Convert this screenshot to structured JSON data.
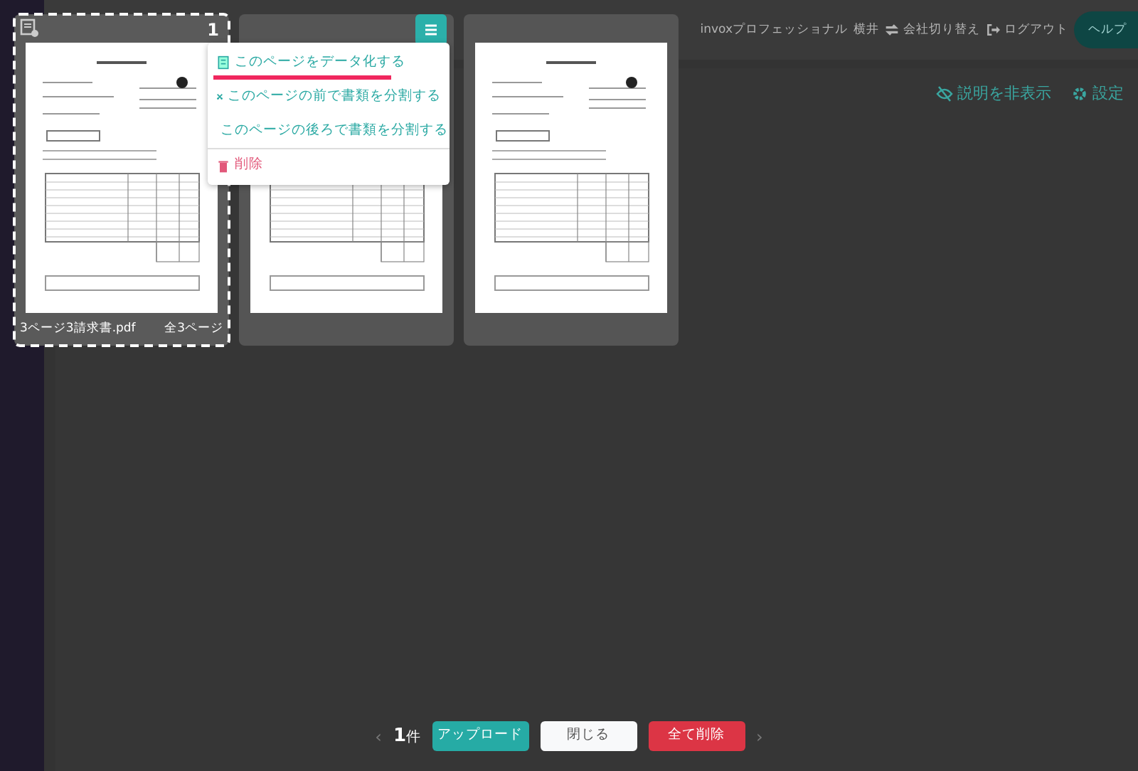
{
  "header": {
    "plan": "invoxプロフェッショナル",
    "user": "横井",
    "links": [
      {
        "kind": "switch",
        "label": "会社切り替え"
      },
      {
        "kind": "logout",
        "label": "ログアウト"
      }
    ],
    "help": "ヘルプ"
  },
  "toolbar": [
    {
      "kind": "hide",
      "label": "説明を非表示"
    },
    {
      "kind": "settings",
      "label": "設定"
    }
  ],
  "pages": [
    {
      "selected": true,
      "number": "1",
      "file_name": "3ページ3請求書.pdf",
      "page_count": "全3ページ"
    },
    {
      "selected": false,
      "menu": [
        {
          "kind": "digitize",
          "label": "このページをデータ化する",
          "highlighted": true
        },
        {
          "kind": "split",
          "label": "このページの前で書類を分割する",
          "highlighted": false
        },
        {
          "kind": "split",
          "label": "このページの後ろで書類を分割する",
          "highlighted": false
        },
        {
          "kind": "delete",
          "label": "削除",
          "highlighted": false
        }
      ]
    },
    {
      "selected": false
    }
  ],
  "pager": {
    "prev": "‹",
    "next": "›",
    "count": "**1**件",
    "buttons": [
      {
        "kind": "upload",
        "label": "アップロード"
      },
      {
        "kind": "close",
        "label": "閉じる"
      },
      {
        "kind": "delete",
        "label": "全て削除"
      }
    ]
  }
}
